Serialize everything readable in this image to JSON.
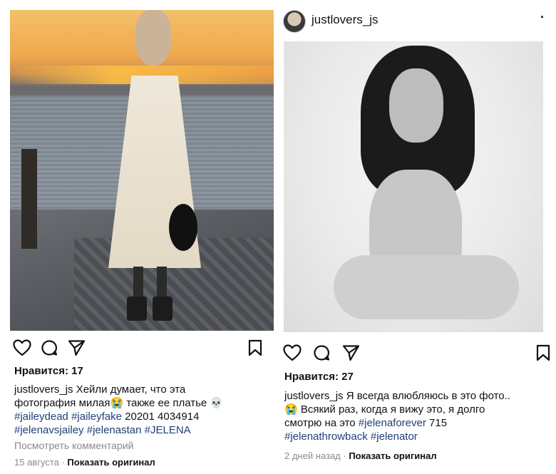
{
  "left_post": {
    "likes": "Нравится: 17",
    "caption": {
      "username": "justlovers_js",
      "line1_rest": " Хейли думает, что эта",
      "line2": "фотография милая😭 также ее платье 💀",
      "line3_tags": [
        "#jaileydead",
        "#jaileyfake"
      ],
      "line3_rest": " 20201 4034914",
      "line4_tags": [
        "#jelenavsjailey",
        "#jelenastan",
        "#JELENA"
      ]
    },
    "view_comments": "Посмотреть комментарий",
    "date": "15 августа",
    "separator": " · ",
    "show_original": "Показать оригинал"
  },
  "right_post": {
    "username": "justlovers_js",
    "more": "·",
    "likes": "Нравится: 27",
    "caption": {
      "username": "justlovers_js",
      "line1_rest": " Я всегда влюбляюсь в это фото..",
      "line2": "😭 Всякий раз, когда я вижу это, я долго",
      "line3_pre": "смотрю на это ",
      "line3_tag": "#jelenaforever",
      "line3_rest": " 715",
      "line4_tags": [
        "#jelenathrowback",
        "#jelenator"
      ]
    },
    "date": "2 дней назад",
    "separator": " · ",
    "show_original": "Показать оригинал"
  },
  "icons": {
    "like": "heart-icon",
    "comment": "comment-icon",
    "share": "paper-plane-icon",
    "save": "bookmark-icon"
  }
}
